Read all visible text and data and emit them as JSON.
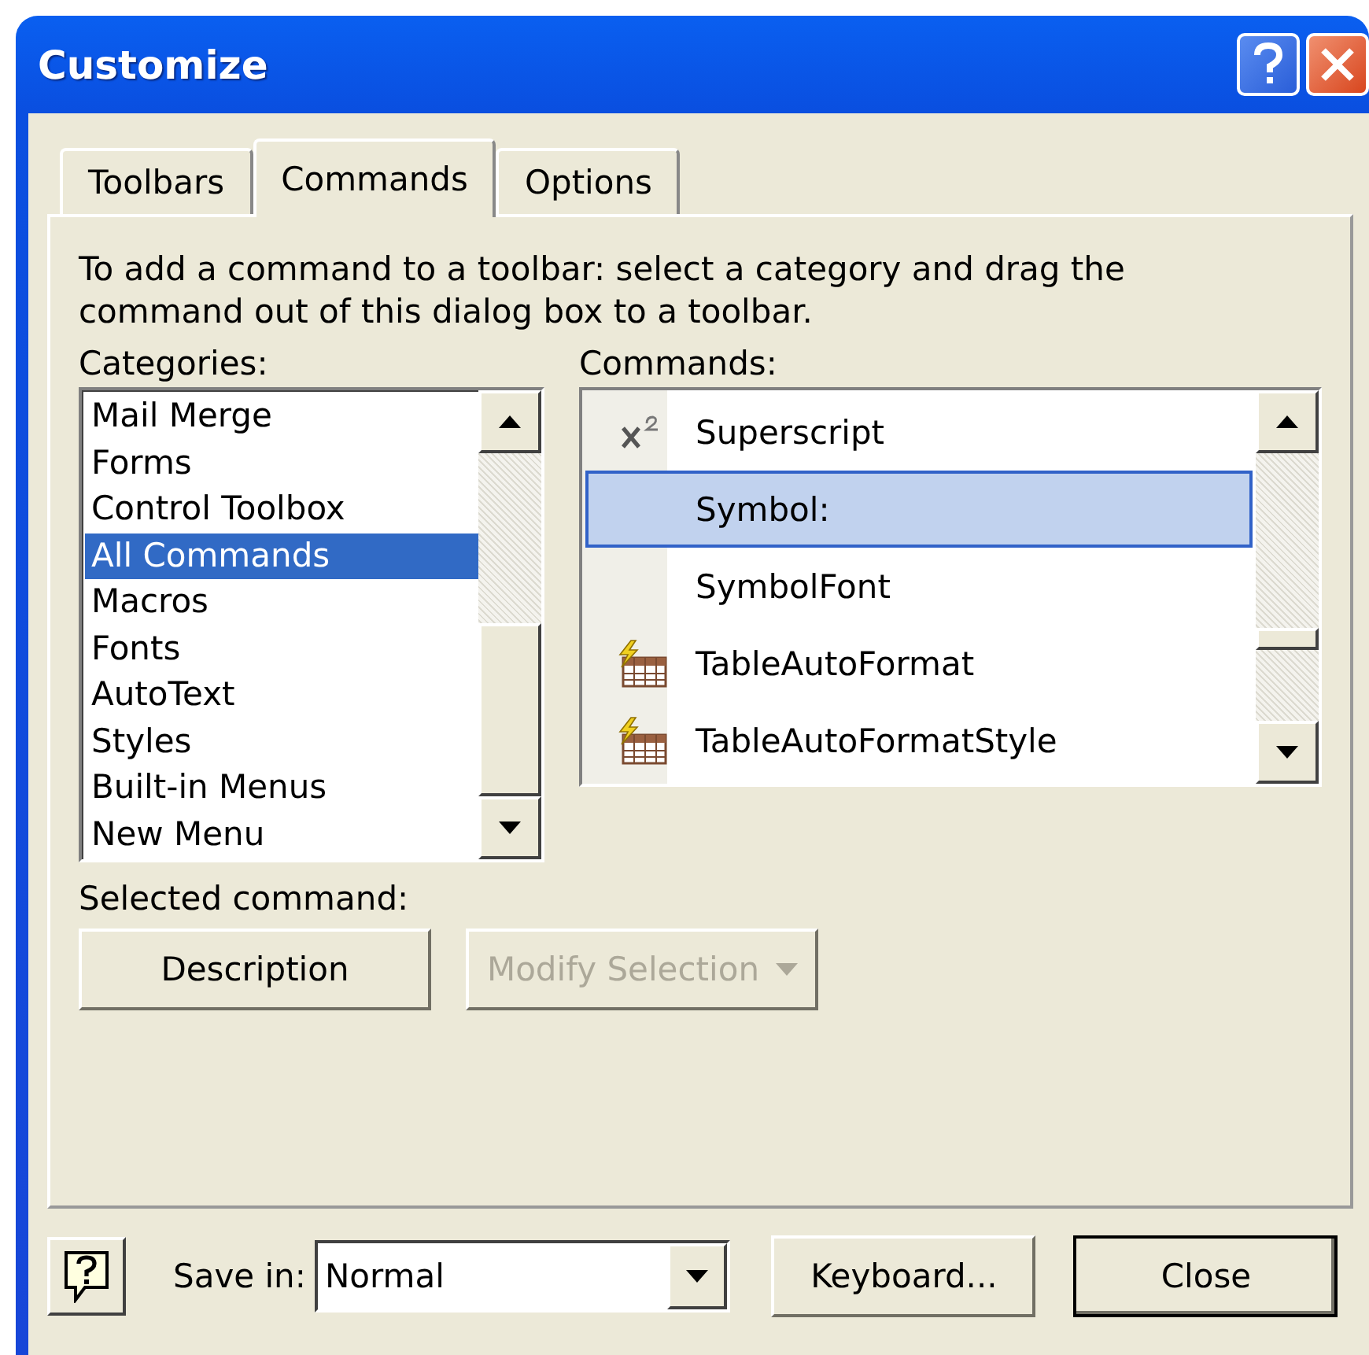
{
  "window": {
    "title": "Customize"
  },
  "tabs": [
    {
      "label": "Toolbars",
      "selected": false
    },
    {
      "label": "Commands",
      "selected": true
    },
    {
      "label": "Options",
      "selected": false
    }
  ],
  "instructions": "To add a command to a toolbar: select a category and drag the command out of this dialog box to a toolbar.",
  "categories": {
    "label": "Categories:",
    "items": [
      {
        "label": "Mail Merge",
        "selected": false
      },
      {
        "label": "Forms",
        "selected": false
      },
      {
        "label": "Control Toolbox",
        "selected": false
      },
      {
        "label": "All Commands",
        "selected": true
      },
      {
        "label": "Macros",
        "selected": false
      },
      {
        "label": "Fonts",
        "selected": false
      },
      {
        "label": "AutoText",
        "selected": false
      },
      {
        "label": "Styles",
        "selected": false
      },
      {
        "label": "Built-in Menus",
        "selected": false
      },
      {
        "label": "New Menu",
        "selected": false
      }
    ]
  },
  "commands": {
    "label": "Commands:",
    "items": [
      {
        "label": "Superscript",
        "kind": "superscript",
        "selected": false
      },
      {
        "label": "Symbol:",
        "kind": "plain",
        "selected": true
      },
      {
        "label": "SymbolFont",
        "kind": "plain",
        "selected": false
      },
      {
        "label": "TableAutoFormat",
        "kind": "table",
        "selected": false
      },
      {
        "label": "TableAutoFormatStyle",
        "kind": "table",
        "selected": false
      }
    ]
  },
  "selected_command": {
    "label": "Selected command:",
    "buttons": [
      {
        "label": "Description",
        "disabled": false,
        "dropdown": false
      },
      {
        "label": "Modify Selection",
        "disabled": true,
        "dropdown": true
      }
    ]
  },
  "footer": {
    "save_in": {
      "label": "Save in:",
      "value": "Normal"
    },
    "buttons": [
      {
        "label": "Keyboard...",
        "default": false
      },
      {
        "label": "Close",
        "default": true
      }
    ]
  }
}
